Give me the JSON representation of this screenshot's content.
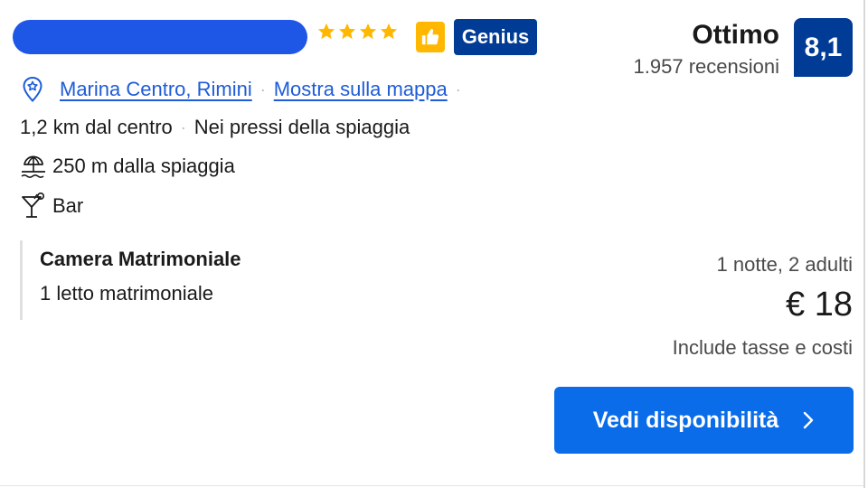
{
  "hotel": {
    "stars": 4,
    "genius_label": "Genius",
    "rating_word": "Ottimo",
    "review_count": "1.957 recensioni",
    "score": "8,1"
  },
  "location": {
    "district": "Marina Centro, Rimini",
    "map_link": "Mostra sulla mappa",
    "distance": "1,2 km dal centro",
    "beach_note": "Nei pressi della spiaggia",
    "beach_distance": "250 m dalla spiaggia",
    "amenity": "Bar"
  },
  "room": {
    "name": "Camera Matrimoniale",
    "bed": "1 letto matrimoniale"
  },
  "pricing": {
    "stay": "1 notte, 2 adulti",
    "price": "€ 18",
    "taxes": "Include tasse e costi"
  },
  "cta": {
    "label": "Vedi disponibilità"
  },
  "icons": {
    "star": "star-icon",
    "thumb": "thumbs-up-icon",
    "pin": "location-pin-icon",
    "beach": "beach-umbrella-icon",
    "bar": "cocktail-icon",
    "chevron": "chevron-right-icon"
  },
  "colors": {
    "brand_blue": "#003b95",
    "link_blue": "#1e5cd8",
    "button_blue": "#0a6ce8",
    "star_yellow": "#ffb700",
    "redaction": "#1e56e6"
  }
}
